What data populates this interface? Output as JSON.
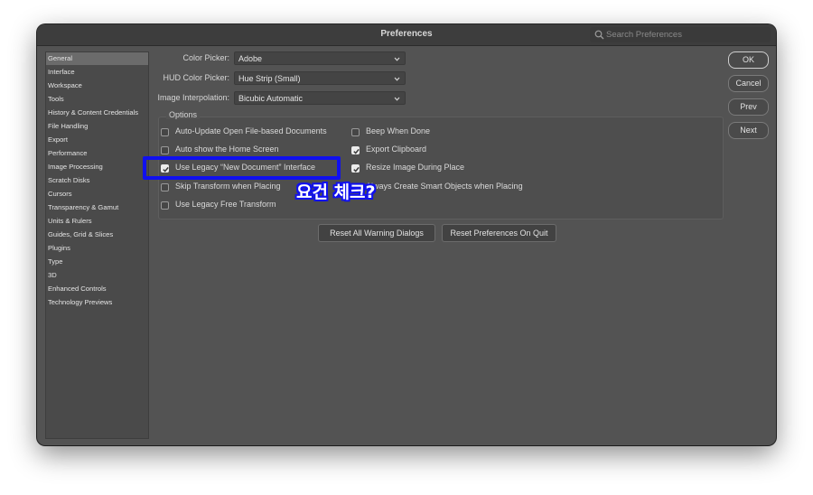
{
  "window": {
    "title": "Preferences"
  },
  "search": {
    "placeholder": "Search Preferences"
  },
  "sidebar": {
    "items": [
      {
        "label": "General"
      },
      {
        "label": "Interface"
      },
      {
        "label": "Workspace"
      },
      {
        "label": "Tools"
      },
      {
        "label": "History & Content Credentials"
      },
      {
        "label": "File Handling"
      },
      {
        "label": "Export"
      },
      {
        "label": "Performance"
      },
      {
        "label": "Image Processing"
      },
      {
        "label": "Scratch Disks"
      },
      {
        "label": "Cursors"
      },
      {
        "label": "Transparency & Gamut"
      },
      {
        "label": "Units & Rulers"
      },
      {
        "label": "Guides, Grid & Slices"
      },
      {
        "label": "Plugins"
      },
      {
        "label": "Type"
      },
      {
        "label": "3D"
      },
      {
        "label": "Enhanced Controls"
      },
      {
        "label": "Technology Previews"
      }
    ],
    "selected": "General"
  },
  "general": {
    "color_picker": {
      "label": "Color Picker:",
      "value": "Adobe"
    },
    "hud_color_picker": {
      "label": "HUD Color Picker:",
      "value": "Hue Strip (Small)"
    },
    "image_interpolation": {
      "label": "Image Interpolation:",
      "value": "Bicubic Automatic"
    },
    "options_title": "Options",
    "options": [
      {
        "label": "Auto-Update Open File-based Documents",
        "checked": false
      },
      {
        "label": "Auto show the Home Screen",
        "checked": false
      },
      {
        "label": "Use Legacy “New Document” Interface",
        "checked": true
      },
      {
        "label": "Skip Transform when Placing",
        "checked": false
      },
      {
        "label": "Use Legacy Free Transform",
        "checked": false
      },
      {
        "label": "Beep When Done",
        "checked": false
      },
      {
        "label": "Export Clipboard",
        "checked": true
      },
      {
        "label": "Resize Image During Place",
        "checked": true
      },
      {
        "label": "Always Create Smart Objects when Placing",
        "checked": false
      }
    ],
    "reset_warning": "Reset All Warning Dialogs",
    "reset_prefs": "Reset Preferences On Quit"
  },
  "actions": {
    "ok": "OK",
    "cancel": "Cancel",
    "prev": "Prev",
    "next": "Next"
  },
  "annotation": {
    "text": "요건 체크?",
    "color": "#1010ee"
  }
}
